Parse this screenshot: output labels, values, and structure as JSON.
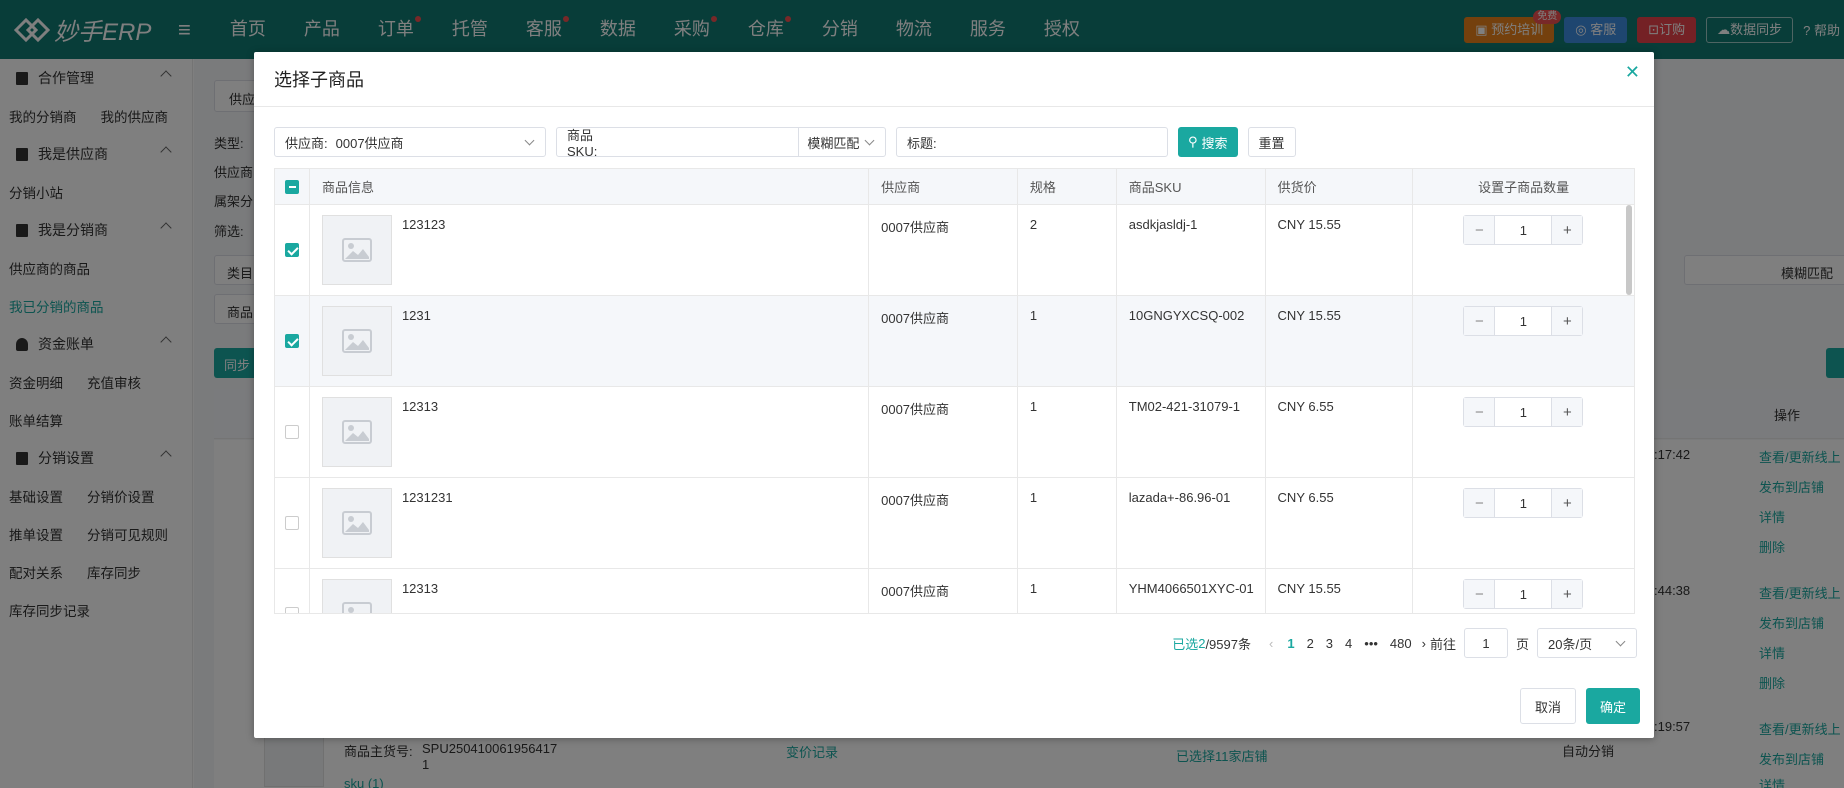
{
  "app": {
    "logo": "妙手ERP"
  },
  "nav": {
    "items": [
      {
        "label": "首页",
        "dot": false
      },
      {
        "label": "产品",
        "dot": false
      },
      {
        "label": "订单",
        "dot": true
      },
      {
        "label": "托管",
        "dot": false
      },
      {
        "label": "客服",
        "dot": true
      },
      {
        "label": "数据",
        "dot": false
      },
      {
        "label": "采购",
        "dot": true
      },
      {
        "label": "仓库",
        "dot": true
      },
      {
        "label": "分销",
        "dot": false
      },
      {
        "label": "物流",
        "dot": false
      },
      {
        "label": "服务",
        "dot": false
      },
      {
        "label": "授权",
        "dot": false
      }
    ],
    "training": "预约培训",
    "training_badge": "免费",
    "service": "客服",
    "subscribe": "订购",
    "sync": "数据同步",
    "help": "帮助"
  },
  "sidebar": {
    "coop": "合作管理",
    "my_distributor": "我的分销商",
    "my_supplier": "我的供应商",
    "i_am_supplier": "我是供应商",
    "dist_station": "分销小站",
    "i_am_distributor": "我是分销商",
    "supplier_goods": "供应商的商品",
    "my_distributed": "我已分销的商品",
    "funds": "资金账单",
    "fund_detail": "资金明细",
    "recharge": "充值审核",
    "bill": "账单结算",
    "dist_settings": "分销设置",
    "basic": "基础设置",
    "price": "分销价设置",
    "push": "推单设置",
    "visible": "分销可见规则",
    "pairing": "配对关系",
    "stock_sync": "库存同步",
    "stock_log": "库存同步记录"
  },
  "background": {
    "f1": "供应",
    "type": "类型:",
    "supp": "供应商",
    "shelf": "属架分",
    "filter": "筛选:",
    "cat": "类目",
    "goods": "商品",
    "sync_btn": "同步",
    "fuzzy": "模糊匹配",
    "ops": "操作",
    "t1": ":17:42",
    "t2": ":44:38",
    "t3": ":19:57",
    "view1": "查看/更新线上",
    "pub1": "发布到店铺",
    "detail1": "详情",
    "del1": "删除",
    "view2": "查看/更新线上",
    "pub2": "发布到店铺",
    "detail2": "详情",
    "del2": "删除",
    "view3": "查看/更新线上",
    "pub3": "发布到店铺",
    "detail3": "详情",
    "spu_label": "商品主货号:",
    "spu": "SPU250410061956417",
    "spu2": "1",
    "price_log": "变价记录",
    "shops": "已选择11家店铺",
    "auto": "自动分销",
    "sku": "sku (1)"
  },
  "modal": {
    "title": "选择子商品",
    "filter": {
      "supplier_label": "供应商:",
      "supplier_value": "0007供应商",
      "sku_label": "商品SKU:",
      "match": "模糊匹配",
      "title_label": "标题:",
      "search": "搜索",
      "reset": "重置"
    },
    "columns": [
      "商品信息",
      "供应商",
      "规格",
      "商品SKU",
      "供货价",
      "设置子商品数量"
    ],
    "rows": [
      {
        "name": "123123",
        "supplier": "0007供应商",
        "spec": "2",
        "sku": "asdkjasldj-1",
        "price": "CNY 15.55",
        "qty": "1",
        "checked": true
      },
      {
        "name": "1231",
        "supplier": "0007供应商",
        "spec": "1",
        "sku": "10GNGYXCSQ-002",
        "price": "CNY 15.55",
        "qty": "1",
        "checked": true
      },
      {
        "name": "12313",
        "supplier": "0007供应商",
        "spec": "1",
        "sku": "TM02-421-31079-1",
        "price": "CNY 6.55",
        "qty": "1",
        "checked": false
      },
      {
        "name": "1231231",
        "supplier": "0007供应商",
        "spec": "1",
        "sku": "lazada+-86.96-01",
        "price": "CNY 6.55",
        "qty": "1",
        "checked": false
      },
      {
        "name": "12313",
        "supplier": "0007供应商",
        "spec": "1",
        "sku": "YHM4066501XYC-01",
        "price": "CNY 15.55",
        "qty": "1",
        "checked": false
      }
    ],
    "pager": {
      "selected_label": "已选",
      "selected": "2",
      "total": "/9597条",
      "pages": [
        "1",
        "2",
        "3",
        "4"
      ],
      "ellipsis": "•••",
      "last": "480",
      "goto": "前往",
      "goto_value": "1",
      "page_unit": "页",
      "per_page": "20条/页"
    },
    "cancel": "取消",
    "ok": "确定"
  },
  "colors": {
    "primary": "#1aa8a0",
    "nav": "#117a73"
  }
}
